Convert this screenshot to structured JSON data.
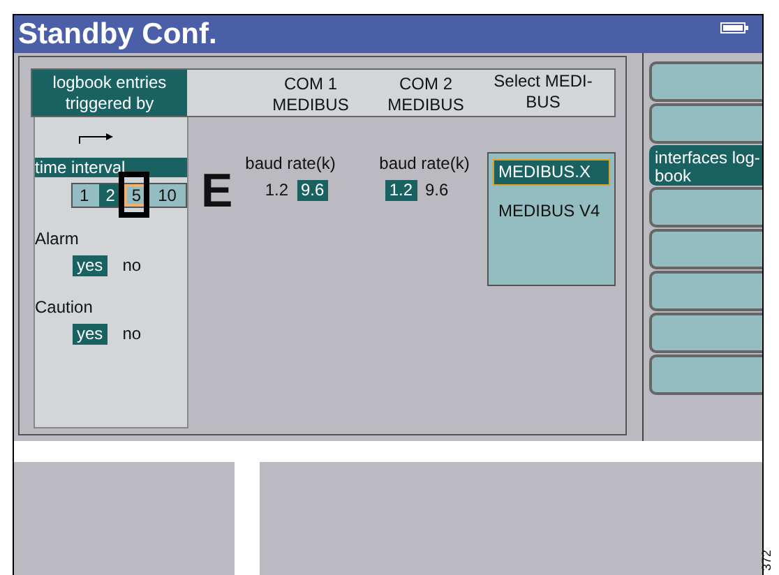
{
  "window": {
    "title": "Standby Conf."
  },
  "header": {
    "logbook_heading": "logbook entries triggered by",
    "columns": [
      "COM 1 MEDIBUS",
      "COM 2 MEDIBUS",
      "Select MEDI-BUS"
    ]
  },
  "time_interval": {
    "label": "time interval",
    "options": [
      {
        "label": "1",
        "selected": false,
        "focused": false
      },
      {
        "label": "2",
        "selected": true,
        "focused": false
      },
      {
        "label": "5",
        "selected": false,
        "focused": true
      },
      {
        "label": "10",
        "selected": false,
        "focused": false
      }
    ]
  },
  "triggers": [
    {
      "label": "Alarm",
      "options": [
        {
          "label": "yes",
          "selected": true
        },
        {
          "label": "no",
          "selected": false
        }
      ]
    },
    {
      "label": "Caution",
      "options": [
        {
          "label": "yes",
          "selected": true
        },
        {
          "label": "no",
          "selected": false
        }
      ]
    }
  ],
  "callout": "E",
  "com_ports": [
    {
      "label": "baud rate(k)",
      "options": [
        {
          "label": "1.2",
          "selected": false
        },
        {
          "label": "9.6",
          "selected": true
        }
      ]
    },
    {
      "label": "baud rate(k)",
      "options": [
        {
          "label": "1.2",
          "selected": true
        },
        {
          "label": "9.6",
          "selected": false
        }
      ]
    }
  ],
  "medibus_options": [
    {
      "label": "MEDIBUS.X",
      "selected": true,
      "focused": true
    },
    {
      "label": "MEDIBUS V4",
      "selected": false,
      "focused": false
    }
  ],
  "side_buttons": [
    {
      "active": false
    },
    {
      "active": false
    },
    {
      "label": "interfaces log-book",
      "active": true
    },
    {
      "active": false
    },
    {
      "active": false
    },
    {
      "active": false
    },
    {
      "active": false
    },
    {
      "active": false
    }
  ],
  "figure_number": "372"
}
